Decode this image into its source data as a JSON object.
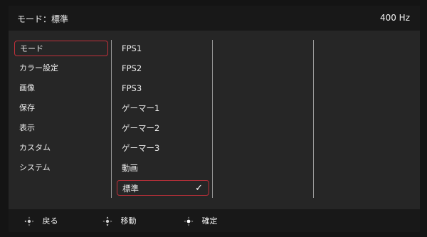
{
  "header": {
    "title": "モード：標準",
    "refresh_rate": "400 Hz"
  },
  "main_menu": {
    "items": [
      {
        "label": "モード"
      },
      {
        "label": "カラー設定"
      },
      {
        "label": "画像"
      },
      {
        "label": "保存"
      },
      {
        "label": "表示"
      },
      {
        "label": "カスタム"
      },
      {
        "label": "システム"
      }
    ],
    "selected_label": "モード"
  },
  "mode_menu": {
    "items": [
      {
        "label": "FPS1"
      },
      {
        "label": "FPS2"
      },
      {
        "label": "FPS3"
      },
      {
        "label": "ゲーマー1"
      },
      {
        "label": "ゲーマー2"
      },
      {
        "label": "ゲーマー3"
      },
      {
        "label": "動画"
      },
      {
        "label": "標準"
      }
    ],
    "selected_label": "標準",
    "selected_check": "✓"
  },
  "footer": {
    "back_label": "戻る",
    "move_label": "移動",
    "confirm_label": "確定"
  },
  "colors": {
    "selection_border": "#c0303a",
    "background": "#262626",
    "bar": "#181818"
  },
  "icons": {
    "footer_back": "dpad-left-icon",
    "footer_move": "dpad-updown-icon",
    "footer_confirm": "dpad-center-icon",
    "selected_mark": "checkmark-icon"
  }
}
